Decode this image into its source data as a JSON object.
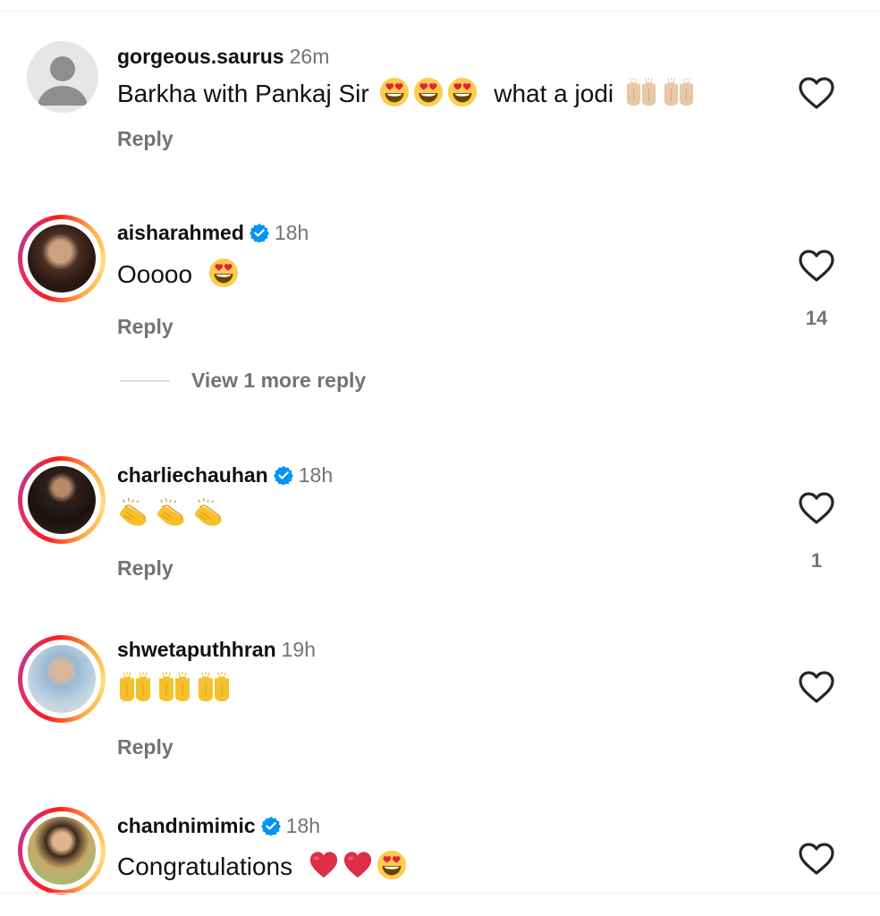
{
  "comments": [
    {
      "username": "gorgeous.saurus",
      "time": "26m",
      "verified": false,
      "text": "Barkha with Pankaj Sir",
      "text_after": "what a jodi",
      "emojis": [
        "heart-eyes",
        "heart-eyes",
        "heart-eyes",
        "raising-hands",
        "raising-hands"
      ],
      "reply_label": "Reply",
      "likes": ""
    },
    {
      "username": "aisharahmed",
      "time": "18h",
      "verified": true,
      "text": "Ooooo",
      "emojis": [
        "heart-eyes"
      ],
      "reply_label": "Reply",
      "likes": "14",
      "view_more": "View 1 more reply"
    },
    {
      "username": "charliechauhan",
      "time": "18h",
      "verified": true,
      "text": "",
      "emojis": [
        "clapping-hands",
        "clapping-hands",
        "clapping-hands"
      ],
      "reply_label": "Reply",
      "likes": "1"
    },
    {
      "username": "shwetaputhhran",
      "time": "19h",
      "verified": false,
      "text": "",
      "emojis": [
        "raising-hands",
        "raising-hands",
        "raising-hands"
      ],
      "reply_label": "Reply",
      "likes": ""
    },
    {
      "username": "chandnimimic",
      "time": "18h",
      "verified": true,
      "text": "Congratulations",
      "emojis": [
        "red-heart",
        "red-heart",
        "heart-eyes"
      ],
      "likes": ""
    }
  ],
  "colors": {
    "verified_blue": "#0095f6",
    "muted_gray": "#737373",
    "story_ring_start": "#fd1d1d",
    "story_ring_end": "#fcaf45"
  }
}
